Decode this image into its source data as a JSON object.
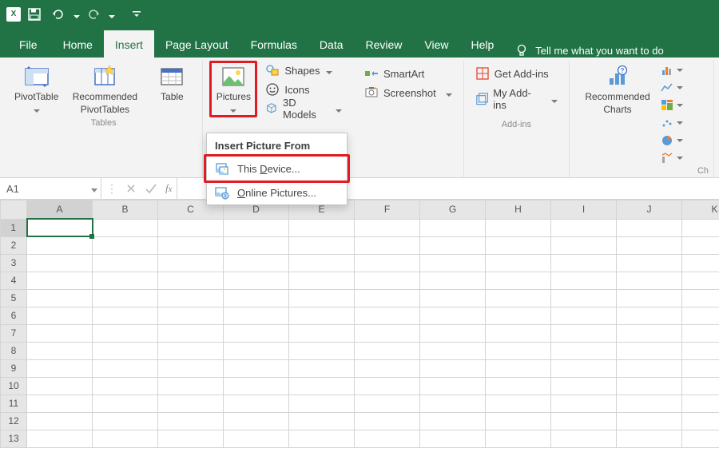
{
  "qat": {
    "undo": "Undo",
    "redo": "Redo",
    "save": "Save"
  },
  "tabs": {
    "file": "File",
    "home": "Home",
    "insert": "Insert",
    "page_layout": "Page Layout",
    "formulas": "Formulas",
    "data": "Data",
    "review": "Review",
    "view": "View",
    "help": "Help"
  },
  "tell_me": "Tell me what you want to do",
  "ribbon": {
    "tables_group": "Tables",
    "pivot": "PivotTable",
    "rec_pivot_line1": "Recommended",
    "rec_pivot_line2": "PivotTables",
    "table": "Table",
    "pictures": "Pictures",
    "shapes": "Shapes",
    "icons": "Icons",
    "models": "3D Models",
    "smartart": "SmartArt",
    "screenshot": "Screenshot",
    "get_addins": "Get Add-ins",
    "my_addins": "My Add-ins",
    "addins_group": "Add-ins",
    "rec_charts_line1": "Recommended",
    "rec_charts_line2": "Charts",
    "charts_group_partial": "Ch"
  },
  "menu": {
    "title": "Insert Picture From",
    "this_device_pre": "This ",
    "this_device_u": "D",
    "this_device_post": "evice...",
    "online_pre": "",
    "online_u": "O",
    "online_post": "nline Pictures..."
  },
  "formula_bar": {
    "name_box": "A1",
    "value": ""
  },
  "grid": {
    "columns": [
      "A",
      "B",
      "C",
      "D",
      "E",
      "F",
      "G",
      "H",
      "I",
      "J",
      "K"
    ],
    "rows": [
      1,
      2,
      3,
      4,
      5,
      6,
      7,
      8,
      9,
      10,
      11,
      12,
      13
    ],
    "selected": {
      "row": 1,
      "col": "A"
    }
  }
}
